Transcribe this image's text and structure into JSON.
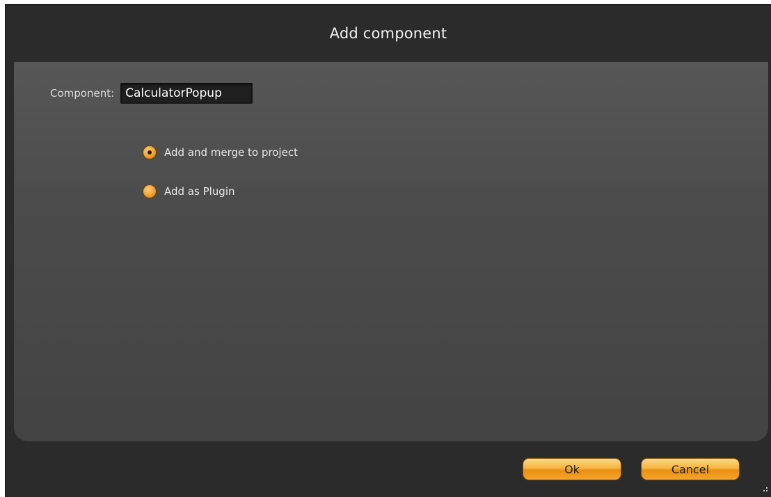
{
  "window": {
    "title": "Add component"
  },
  "form": {
    "component_label": "Component:",
    "component_value": "CalculatorPopup"
  },
  "options": [
    {
      "label": "Add and merge to project",
      "checked": true
    },
    {
      "label": "Add as Plugin",
      "checked": false
    }
  ],
  "buttons": {
    "ok_label": "Ok",
    "cancel_label": "Cancel"
  },
  "colors": {
    "dialog_bg": "#2b2b2b",
    "panel_bg": "#4c4c4c",
    "accent": "#f39a26"
  }
}
